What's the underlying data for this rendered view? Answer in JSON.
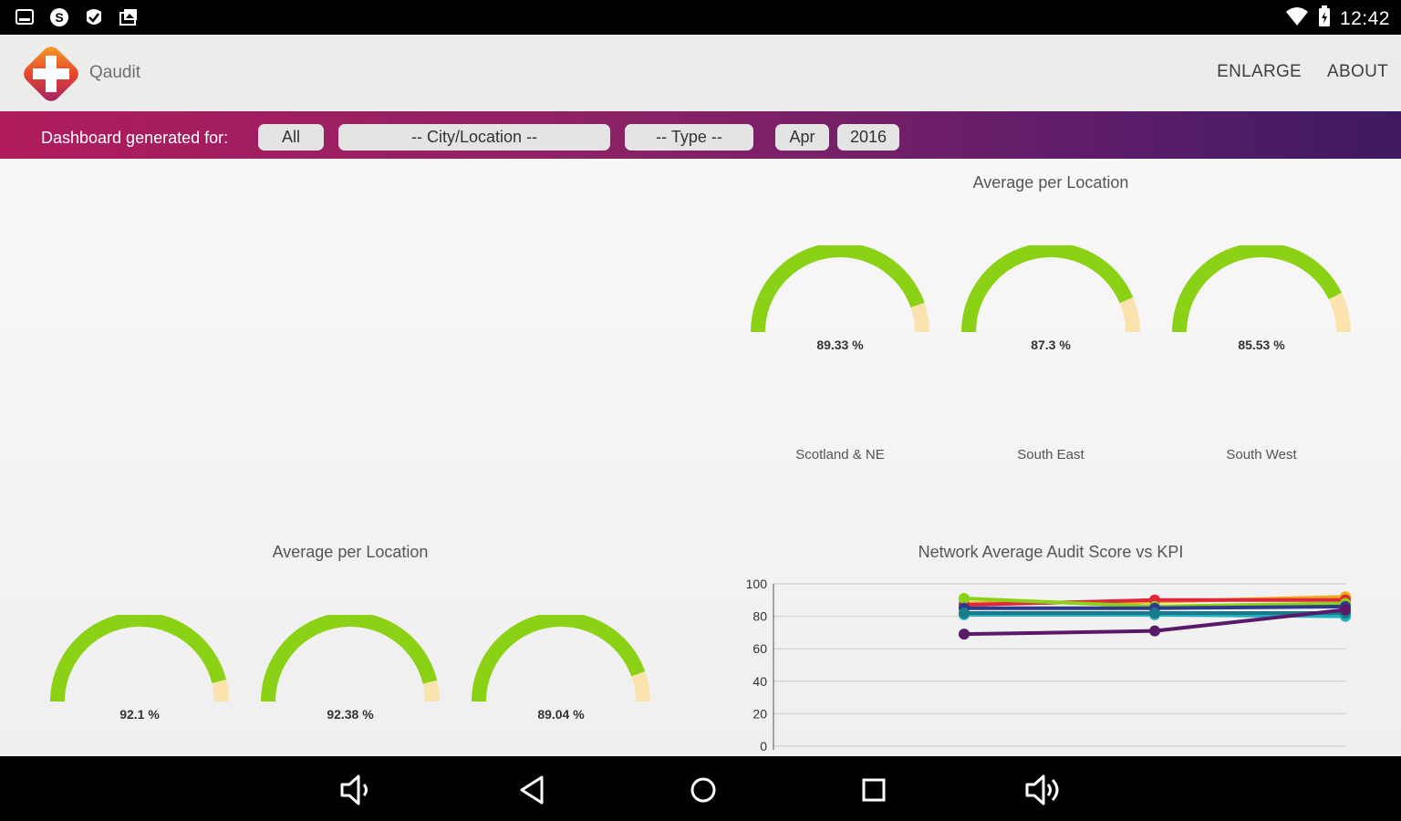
{
  "status_bar": {
    "left_icons": [
      "screenshot-icon",
      "skype-icon",
      "checkmark-app-icon",
      "photo-icon"
    ],
    "right_icons": [
      "wifi-icon",
      "battery-icon"
    ],
    "time": "12:42"
  },
  "header": {
    "app_name": "Qaudit",
    "actions": [
      "ENLARGE",
      "ABOUT"
    ]
  },
  "filter_bar": {
    "label": "Dashboard generated for:",
    "region": "All",
    "city": "-- City/Location --",
    "type": "-- Type --",
    "month": "Apr",
    "year": "2016"
  },
  "colors": {
    "gauge_green": "#8bd116",
    "gauge_remainder": "#fbe3b0",
    "filter_gradient_start": "#b01c5c",
    "filter_gradient_end": "#3e1a62"
  },
  "panels": {
    "top_right": {
      "title": "Average per Location",
      "gauges": [
        {
          "value": 89.33,
          "label": "89.33 %",
          "location": "Scotland & NE"
        },
        {
          "value": 87.3,
          "label": "87.3 %",
          "location": "South East"
        },
        {
          "value": 85.53,
          "label": "85.53 %",
          "location": "South West"
        }
      ]
    },
    "bottom_left": {
      "title": "Average per Location",
      "gauges": [
        {
          "value": 92.1,
          "label": "92.1 %"
        },
        {
          "value": 92.38,
          "label": "92.38 %"
        },
        {
          "value": 89.04,
          "label": "89.04 %"
        }
      ]
    },
    "bottom_right": {
      "title": "Network Average Audit Score vs KPI"
    }
  },
  "chart_data": {
    "type": "line",
    "title": "Network Average Audit Score vs KPI",
    "x": [
      1,
      2,
      3
    ],
    "ylim": [
      0,
      100
    ],
    "yticks": [
      0,
      20,
      40,
      60,
      80,
      100
    ],
    "grid": true,
    "series": [
      {
        "color": "#f4a81c",
        "values": [
          88,
          89,
          92
        ]
      },
      {
        "color": "#e0263c",
        "values": [
          87,
          90,
          90
        ]
      },
      {
        "color": "#8bd116",
        "values": [
          91,
          86,
          88
        ]
      },
      {
        "color": "#2e3a8c",
        "values": [
          85,
          85,
          86
        ]
      },
      {
        "color": "#1fb0c0",
        "values": [
          81,
          81,
          80
        ]
      },
      {
        "color": "#1a7a8a",
        "values": [
          82,
          82,
          82
        ]
      },
      {
        "color": "#5a1a6a",
        "values": [
          69,
          71,
          84
        ]
      }
    ]
  },
  "nav_bar": {
    "buttons": [
      "volume-down-icon",
      "back-icon",
      "home-icon",
      "recents-icon",
      "volume-up-icon"
    ]
  }
}
